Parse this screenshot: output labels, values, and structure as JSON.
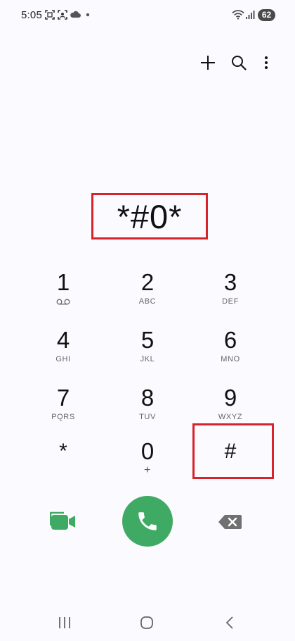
{
  "status_bar": {
    "time": "5:05",
    "battery": "62",
    "icons": [
      "screenshot-icon",
      "screen-recorder-icon",
      "cloud-icon",
      "notification-dot-icon",
      "wifi-icon",
      "signal-icon"
    ]
  },
  "toolbar": {
    "icons": [
      "add-icon",
      "search-icon",
      "more-options-icon"
    ]
  },
  "dialer": {
    "input": "*#0*",
    "keys": [
      {
        "digit": "1",
        "sub": ""
      },
      {
        "digit": "2",
        "sub": "ABC"
      },
      {
        "digit": "3",
        "sub": "DEF"
      },
      {
        "digit": "4",
        "sub": "GHI"
      },
      {
        "digit": "5",
        "sub": "JKL"
      },
      {
        "digit": "6",
        "sub": "MNO"
      },
      {
        "digit": "7",
        "sub": "PQRS"
      },
      {
        "digit": "8",
        "sub": "TUV"
      },
      {
        "digit": "9",
        "sub": "WXYZ"
      },
      {
        "digit": "*",
        "sub": ""
      },
      {
        "digit": "0",
        "sub": "+"
      },
      {
        "digit": "#",
        "sub": ""
      }
    ]
  },
  "actions": {
    "icons": [
      "video-call-icon",
      "phone-icon",
      "backspace-icon"
    ],
    "accent_color": "#3faa63"
  },
  "nav_bar": {
    "icons": [
      "recents-icon",
      "home-icon",
      "back-icon"
    ]
  }
}
